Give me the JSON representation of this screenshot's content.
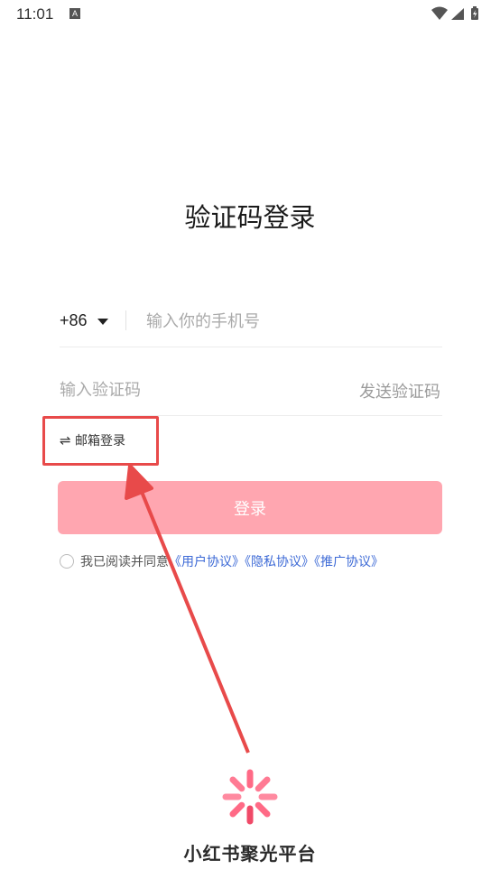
{
  "status_bar": {
    "time": "11:01",
    "notification_icon": "A"
  },
  "title": "验证码登录",
  "phone": {
    "country_code": "+86",
    "placeholder": "输入你的手机号",
    "value": ""
  },
  "verification": {
    "placeholder": "输入验证码",
    "value": "",
    "send_label": "发送验证码"
  },
  "email_login": {
    "icon": "⇌",
    "label": "邮箱登录"
  },
  "login_button": {
    "label": "登录"
  },
  "agreement": {
    "prefix": "我已阅读并同意",
    "user_agreement": "《用户协议》",
    "privacy_agreement": "《隐私协议》",
    "promo_agreement": "《推广协议》",
    "checked": false
  },
  "brand": {
    "name": "小红书聚光平台"
  },
  "colors": {
    "accent": "#ffa6b0",
    "annotation_red": "#e84a4a",
    "link_blue": "#3d6ad6"
  }
}
